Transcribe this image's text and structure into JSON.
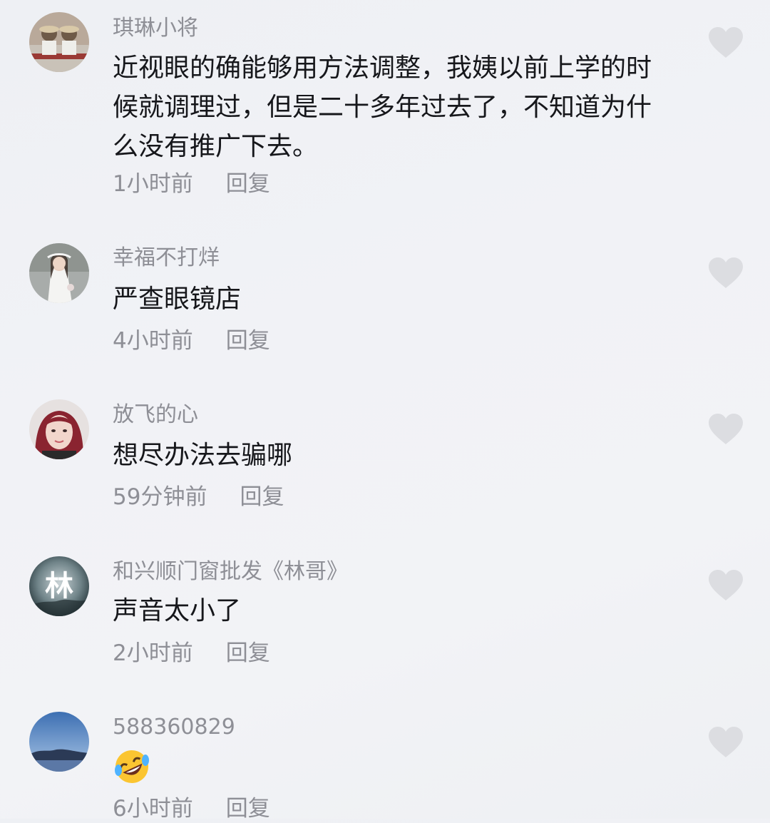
{
  "comments": [
    {
      "username": "琪琳小将",
      "content": "近视眼的确能够用方法调整，我姨以前上学的时候就调理过，但是二十多年过去了，不知道为什么没有推广下去。",
      "time": "1小时前",
      "reply_label": "回复"
    },
    {
      "username": "幸福不打烊",
      "content": "严查眼镜店",
      "time": "4小时前",
      "reply_label": "回复"
    },
    {
      "username": "放飞的心",
      "content": "想尽办法去骗哪",
      "time": "59分钟前",
      "reply_label": "回复"
    },
    {
      "username": "和兴顺门窗批发《林哥》",
      "content": "声音太小了",
      "time": "2小时前",
      "reply_label": "回复",
      "avatar_text": "林"
    },
    {
      "username": "588360829",
      "content": "",
      "content_emoji": "rolling-on-floor-laughing-emoji",
      "time": "6小时前",
      "reply_label": "回复"
    }
  ],
  "icons": {
    "like": "heart-icon"
  },
  "colors": {
    "background": "#f1f2f6",
    "username": "#8e8f96",
    "content": "#16171b",
    "meta": "#8e8f96",
    "like_icon": "#dcdde1"
  }
}
